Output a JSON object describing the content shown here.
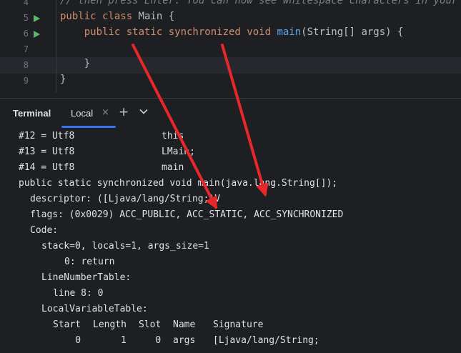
{
  "editor": {
    "lines": [
      {
        "num": "4",
        "run": false,
        "tokens": [
          {
            "t": "// then press Enter. You can now see whitespace characters in your code.",
            "c": "cm"
          }
        ]
      },
      {
        "num": "5",
        "run": true,
        "tokens": [
          {
            "t": "public class ",
            "c": "kw"
          },
          {
            "t": "Main {",
            "c": ""
          }
        ]
      },
      {
        "num": "6",
        "run": true,
        "tokens": [
          {
            "t": "    public static synchronized void ",
            "c": "kw"
          },
          {
            "t": "main",
            "c": "fn"
          },
          {
            "t": "(String[] args) {",
            "c": ""
          }
        ]
      },
      {
        "num": "7",
        "run": false,
        "tokens": []
      },
      {
        "num": "8",
        "run": false,
        "tokens": [
          {
            "t": "    }",
            "c": ""
          }
        ]
      },
      {
        "num": "9",
        "run": false,
        "tokens": [
          {
            "t": "}",
            "c": ""
          }
        ]
      }
    ]
  },
  "terminal": {
    "title": "Terminal",
    "tab_label": "Local",
    "close_glyph": "×",
    "add_glyph": "+",
    "const_rows": [
      {
        "id": "#12 = Utf8",
        "val": "this"
      },
      {
        "id": "#13 = Utf8",
        "val": "LMain;"
      },
      {
        "id": "#14 = Utf8",
        "val": "main"
      }
    ],
    "lines": [
      {
        "indent": 0,
        "text": "public static synchronized void main(java.lang.String[]);"
      },
      {
        "indent": 1,
        "text": "descriptor: ([Ljava/lang/String;)V"
      },
      {
        "indent": 1,
        "text": "flags: (0x0029) ACC_PUBLIC, ACC_STATIC, ACC_SYNCHRONIZED"
      },
      {
        "indent": 1,
        "text": "Code:"
      },
      {
        "indent": 2,
        "text": "stack=0, locals=1, args_size=1"
      },
      {
        "indent": 4,
        "text": "0: return"
      },
      {
        "indent": 2,
        "text": "LineNumberTable:"
      },
      {
        "indent": 3,
        "text": "line 8: 0"
      },
      {
        "indent": 2,
        "text": "LocalVariableTable:"
      }
    ],
    "lvt_header": [
      "Start",
      "Length",
      "Slot",
      "Name",
      "Signature"
    ],
    "lvt_row": [
      "0",
      "1",
      "0",
      "args",
      "[Ljava/lang/String;"
    ]
  },
  "colors": {
    "background": "#1e1f22",
    "keyword": "#cf8e6d",
    "function": "#56a8f5",
    "text": "#bcbec4",
    "arrow": "#e8272a",
    "run_icon": "#5fb865",
    "tab_accent": "#3574f0"
  }
}
